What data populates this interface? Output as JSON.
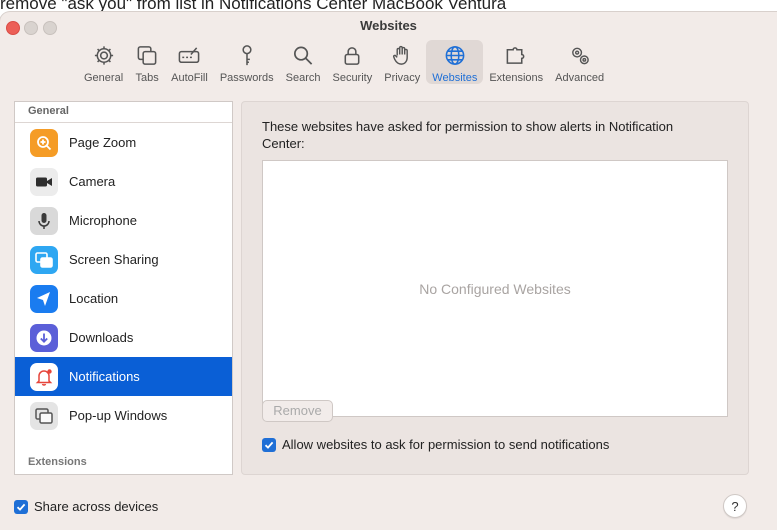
{
  "background_title": "remove \"ask you\" from list in Notifications Center MacBook Ventura",
  "window": {
    "title": "Websites"
  },
  "toolbar": {
    "items": [
      {
        "label": "General",
        "icon": "gear-icon"
      },
      {
        "label": "Tabs",
        "icon": "tabs-icon"
      },
      {
        "label": "AutoFill",
        "icon": "autofill-icon"
      },
      {
        "label": "Passwords",
        "icon": "key-icon"
      },
      {
        "label": "Search",
        "icon": "search-icon"
      },
      {
        "label": "Security",
        "icon": "lock-icon"
      },
      {
        "label": "Privacy",
        "icon": "hand-icon"
      },
      {
        "label": "Websites",
        "icon": "globe-icon",
        "active": true
      },
      {
        "label": "Extensions",
        "icon": "puzzle-icon"
      },
      {
        "label": "Advanced",
        "icon": "gears-icon"
      }
    ]
  },
  "sidebar": {
    "section_general": "General",
    "items": [
      {
        "label": "Page Zoom",
        "icon": "page-zoom-icon",
        "color": "#f59c26"
      },
      {
        "label": "Camera",
        "icon": "camera-icon",
        "color": "#6b6b6b"
      },
      {
        "label": "Microphone",
        "icon": "microphone-icon",
        "color": "#8d8d8d"
      },
      {
        "label": "Screen Sharing",
        "icon": "screen-sharing-icon",
        "color": "#2ea7f2"
      },
      {
        "label": "Location",
        "icon": "location-icon",
        "color": "#1a7cf0"
      },
      {
        "label": "Downloads",
        "icon": "downloads-icon",
        "color": "#5b5fd8"
      },
      {
        "label": "Notifications",
        "icon": "notifications-icon",
        "color": "#ffffff",
        "selected": true
      },
      {
        "label": "Pop-up Windows",
        "icon": "popup-windows-icon",
        "color": "#9a9a9a"
      }
    ],
    "section_extensions": "Extensions"
  },
  "main": {
    "description": "These websites have asked for permission to show alerts in Notification Center:",
    "empty_text": "No Configured Websites",
    "remove_label": "Remove",
    "allow_label": "Allow websites to ask for permission to send notifications",
    "allow_checked": true
  },
  "footer": {
    "share_label": "Share across devices",
    "share_checked": true,
    "help_label": "?"
  },
  "colors": {
    "accent": "#0a5fd6",
    "window_bg": "#f2ebe8"
  }
}
